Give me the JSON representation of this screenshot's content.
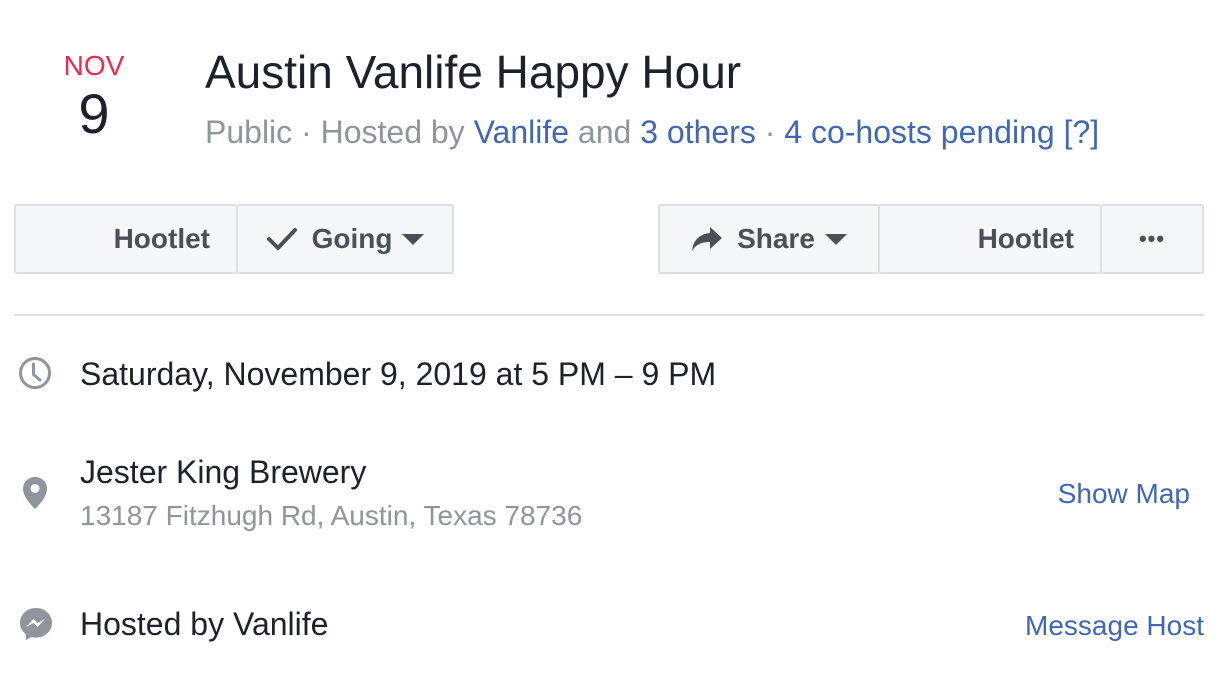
{
  "event": {
    "month": "NOV",
    "day": "9",
    "title": "Austin Vanlife Happy Hour",
    "subtitle": {
      "privacy": "Public",
      "sep1": " · ",
      "hosted_by_prefix": "Hosted by ",
      "host_link": "Vanlife",
      "and_text": " and ",
      "others_link": "3 others",
      "sep2": " · ",
      "cohosts_link": "4 co-hosts pending [?]"
    }
  },
  "actions": {
    "hootlet_left": "Hootlet",
    "going": "Going",
    "share": "Share",
    "hootlet_right": "Hootlet",
    "more": "•••"
  },
  "details": {
    "datetime": "Saturday, November 9, 2019 at 5 PM – 9 PM",
    "venue": "Jester King Brewery",
    "address": "13187 Fitzhugh Rd, Austin, Texas 78736",
    "show_map": "Show Map",
    "hosted_by": "Hosted by Vanlife",
    "message_host": "Message Host"
  },
  "colors": {
    "month_red": "#f02849",
    "link_blue": "#4267b2",
    "muted_gray": "#90949c",
    "button_bg": "#f5f6f7",
    "border": "#dddfe2"
  },
  "icons": {
    "time": "clock-icon",
    "location": "map-pin-icon",
    "host": "messenger-icon",
    "going": "checkmark-icon",
    "share": "share-arrow-icon"
  }
}
